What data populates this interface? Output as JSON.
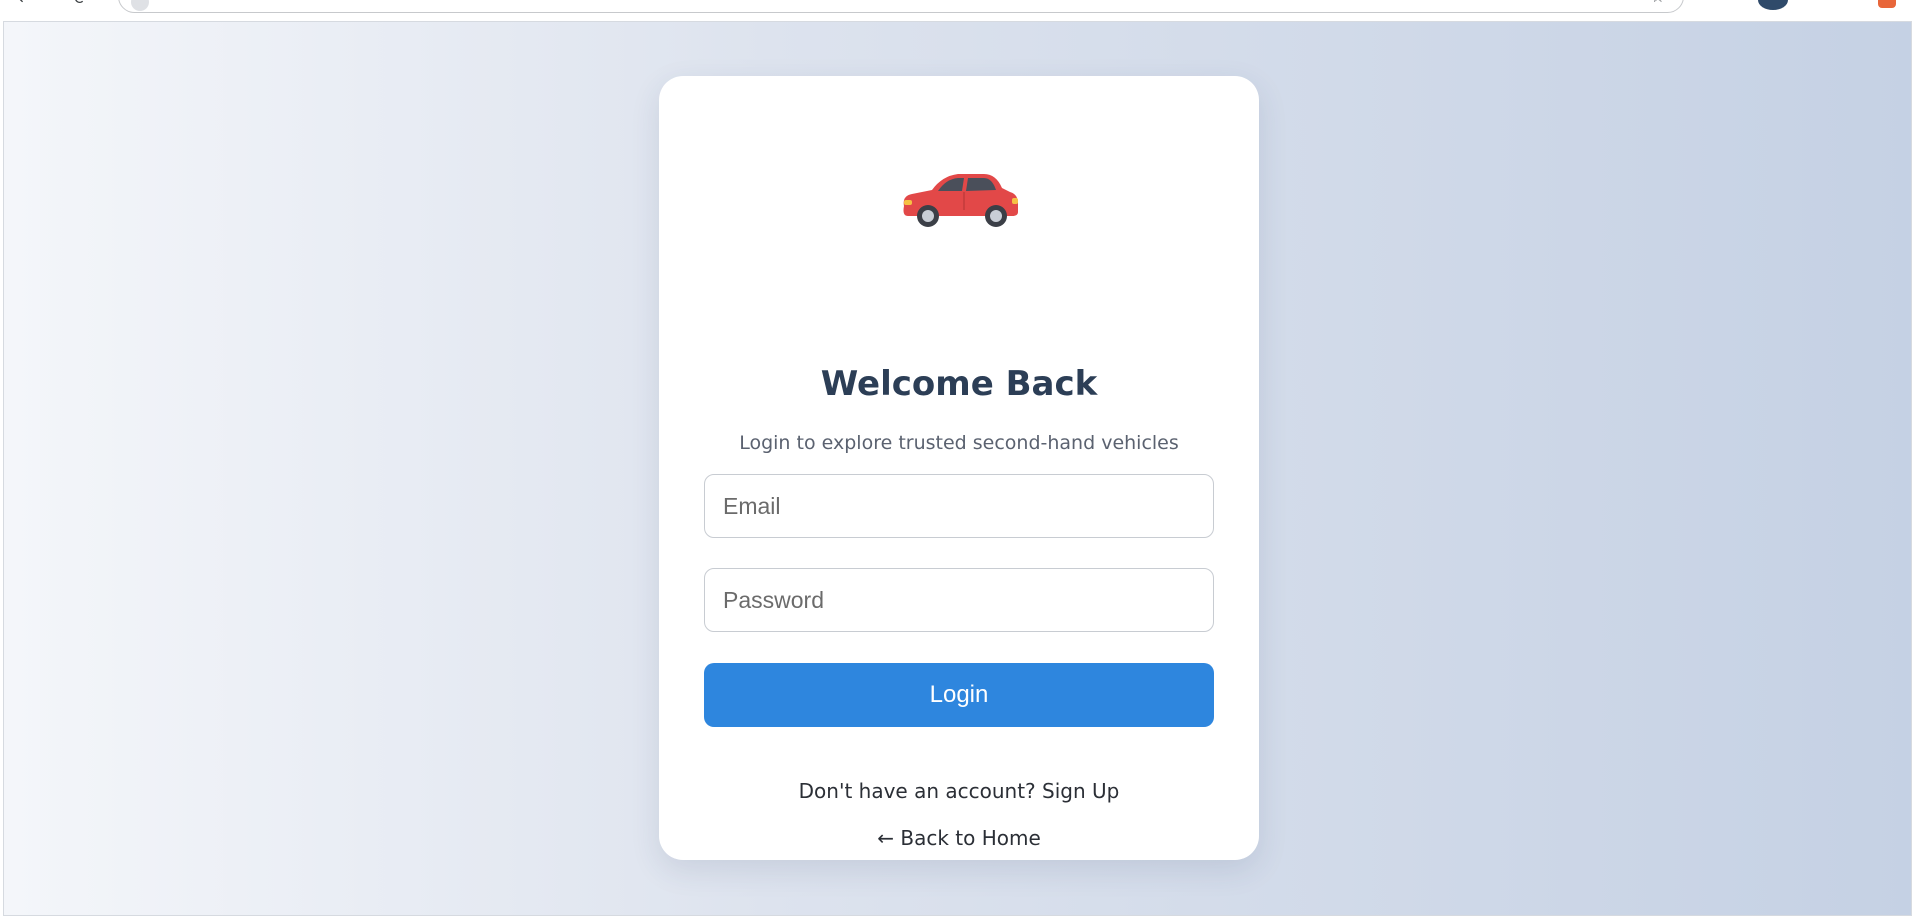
{
  "browser": {
    "back_icon": "arrow-left-icon",
    "reload_icon": "reload-icon",
    "bookmark_icon": "star-icon"
  },
  "login": {
    "logo_icon": "car-icon",
    "title": "Welcome Back",
    "subtitle": "Login to explore trusted second-hand vehicles",
    "email_placeholder": "Email",
    "password_placeholder": "Password",
    "login_button": "Login",
    "signup_prompt": "Don't have an account?",
    "signup_link": "Sign Up",
    "back_link": "← Back to Home"
  },
  "colors": {
    "primary": "#2e86de",
    "title": "#2c3e56",
    "car_body": "#e24848"
  }
}
